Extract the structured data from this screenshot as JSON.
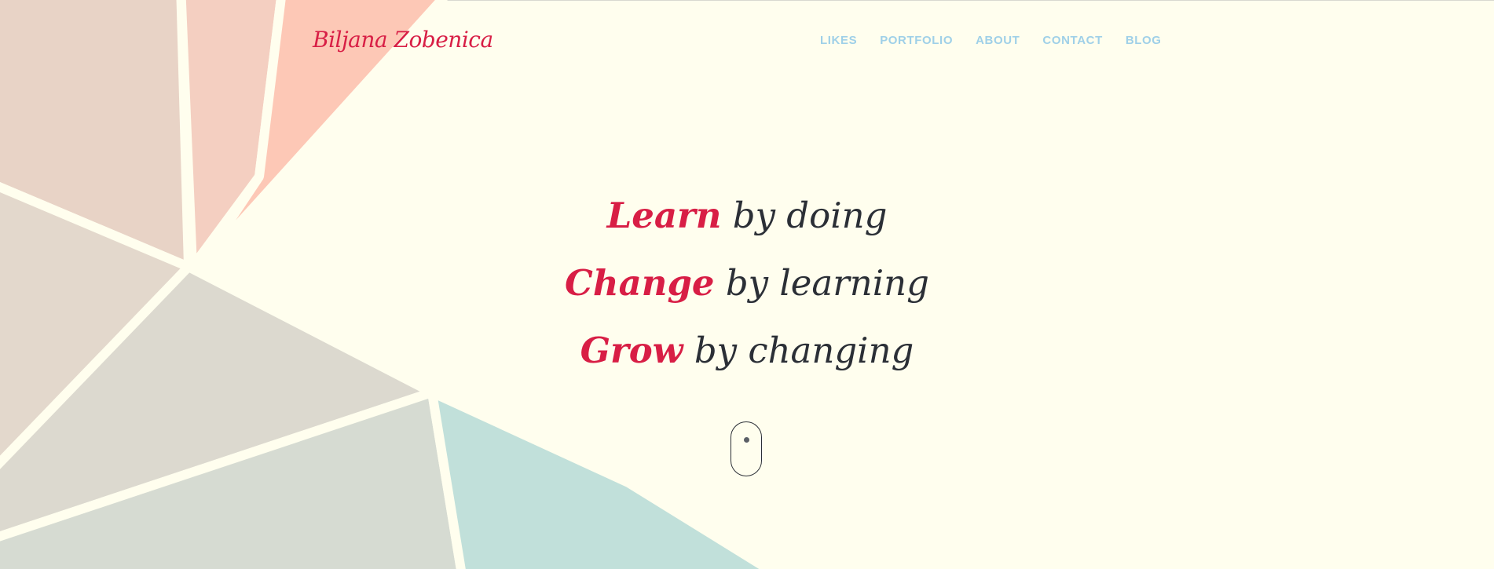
{
  "brand": {
    "name": "Biljana Zobenica"
  },
  "nav": {
    "items": [
      {
        "label": "LIKES"
      },
      {
        "label": "PORTFOLIO"
      },
      {
        "label": "ABOUT"
      },
      {
        "label": "CONTACT"
      },
      {
        "label": "BLOG"
      }
    ]
  },
  "hero": {
    "lines": [
      {
        "keyword": "Learn",
        "rest": "by doing"
      },
      {
        "keyword": "Change",
        "rest": "by learning"
      },
      {
        "keyword": "Grow",
        "rest": "by changing"
      }
    ]
  },
  "scroll_indicator": {
    "icon": "mouse-scroll-icon"
  },
  "colors": {
    "background": "#fffeee",
    "accent_red": "#d81e45",
    "nav_blue": "#9fd0e8",
    "text_dark": "#2b2f36"
  }
}
